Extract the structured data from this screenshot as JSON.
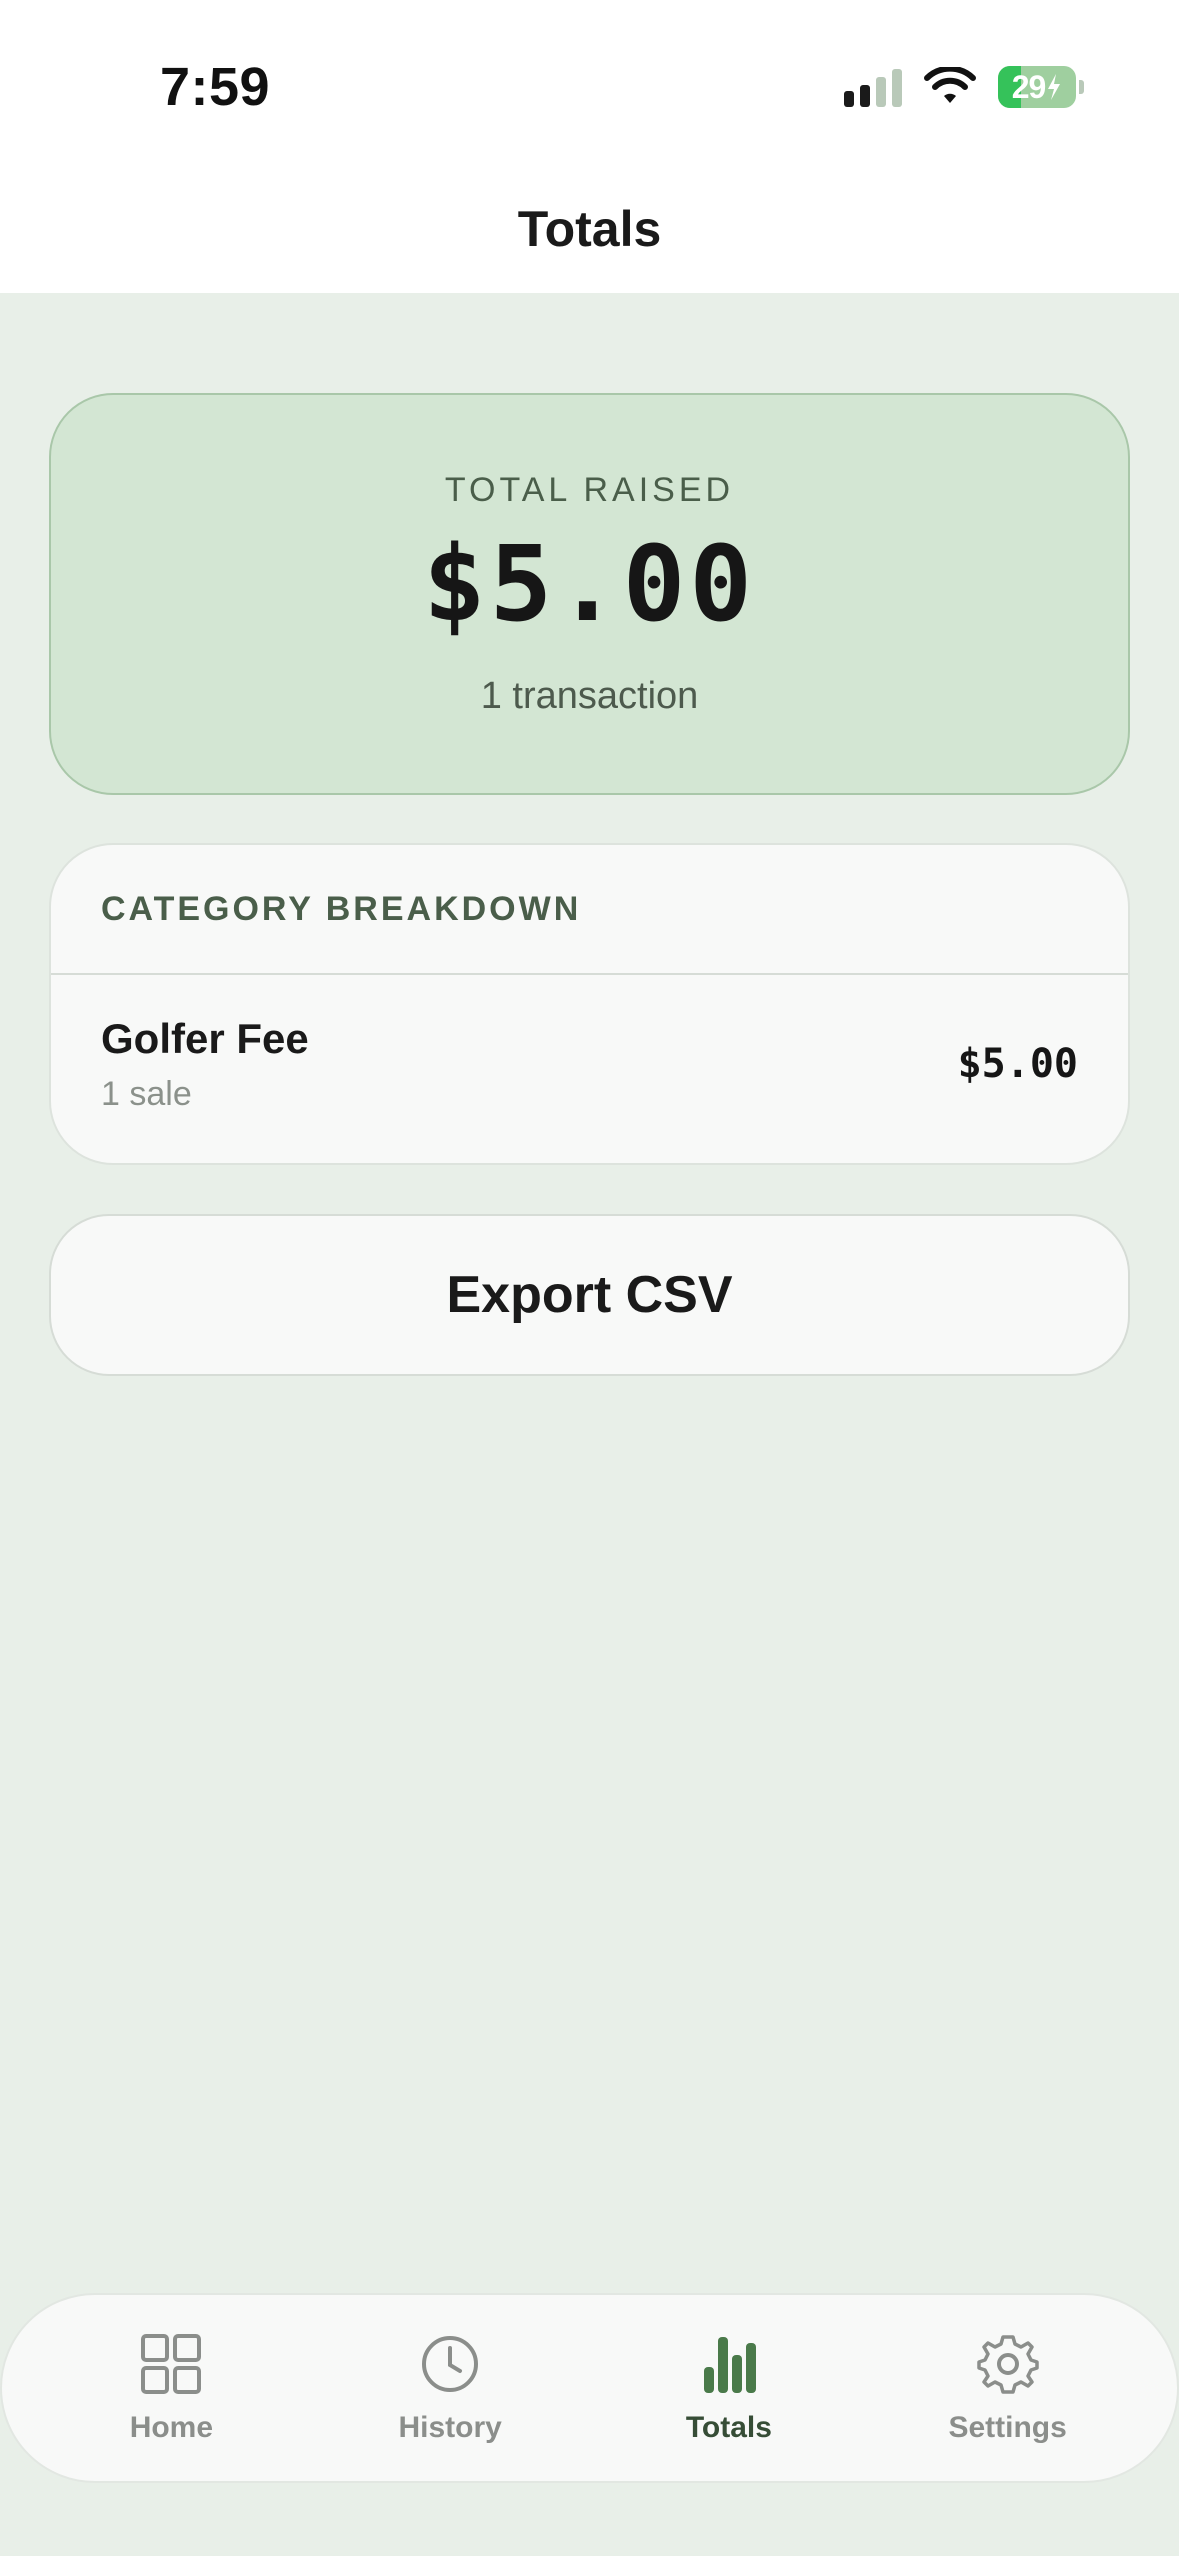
{
  "status_bar": {
    "time": "7:59",
    "battery": "29"
  },
  "header": {
    "title": "Totals"
  },
  "total_card": {
    "label": "TOTAL RAISED",
    "amount": "$5.00",
    "subtitle": "1 transaction"
  },
  "breakdown": {
    "title": "CATEGORY BREAKDOWN",
    "rows": [
      {
        "name": "Golfer Fee",
        "count": "1 sale",
        "amount": "$5.00"
      }
    ]
  },
  "export": {
    "label": "Export CSV"
  },
  "tabs": [
    {
      "label": "Home",
      "icon": "grid-icon",
      "active": false
    },
    {
      "label": "History",
      "icon": "clock-icon",
      "active": false
    },
    {
      "label": "Totals",
      "icon": "bar-chart-icon",
      "active": true
    },
    {
      "label": "Settings",
      "icon": "gear-icon",
      "active": false
    }
  ],
  "colors": {
    "background": "#e8efe8",
    "card_green": "#d3e6d3",
    "accent_green": "#4a7a4a",
    "battery_green": "#35c25a"
  }
}
